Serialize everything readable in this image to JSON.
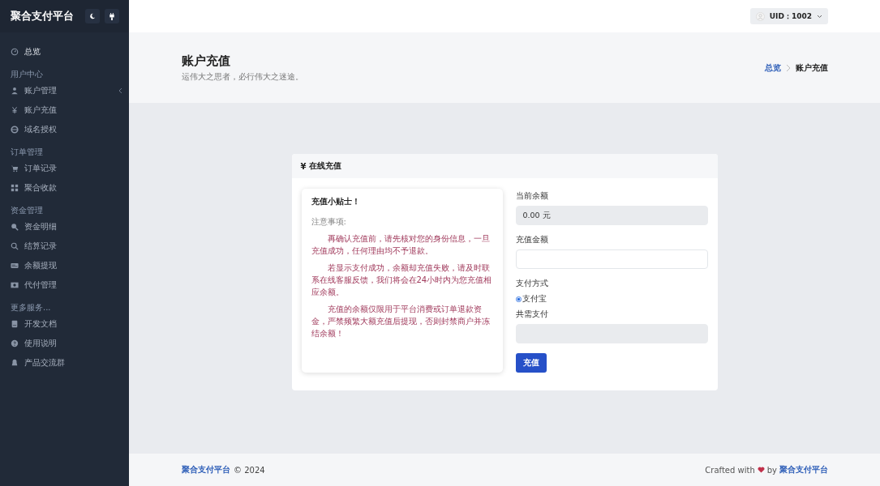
{
  "sidebar": {
    "brand": "聚合支付平台",
    "groups": [
      {
        "items": [
          {
            "label": "总览",
            "expandable": false
          }
        ]
      },
      {
        "title": "用户中心",
        "items": [
          {
            "label": "账户管理",
            "expandable": true
          },
          {
            "label": "账户充值",
            "expandable": false
          },
          {
            "label": "域名授权",
            "expandable": false
          }
        ]
      },
      {
        "title": "订单管理",
        "items": [
          {
            "label": "订单记录",
            "expandable": false
          },
          {
            "label": "聚合收款",
            "expandable": false
          }
        ]
      },
      {
        "title": "资金管理",
        "items": [
          {
            "label": "资金明细",
            "expandable": false
          },
          {
            "label": "结算记录",
            "expandable": false
          },
          {
            "label": "余额提现",
            "expandable": false
          },
          {
            "label": "代付管理",
            "expandable": false
          }
        ]
      },
      {
        "title": "更多服务...",
        "items": [
          {
            "label": "开发文档",
            "expandable": false
          },
          {
            "label": "使用说明",
            "expandable": false
          },
          {
            "label": "产品交流群",
            "expandable": false
          }
        ]
      }
    ]
  },
  "topbar": {
    "user": "UID：1002"
  },
  "page_header": {
    "title": "账户充值",
    "subtitle": "运伟大之思者，必行伟大之迷途。",
    "breadcrumb": [
      {
        "label": "总览",
        "link": true
      },
      {
        "label": "账户充值",
        "link": false
      }
    ]
  },
  "card": {
    "icon_char": "¥",
    "title": "在线充值",
    "tips": {
      "title": "充值小贴士！",
      "note": "注意事项:",
      "paragraphs": [
        "再确认充值前，请先核对您的身份信息，一旦充值成功，任何理由均不予退款。",
        "若显示支付成功，余额却充值失败，请及时联系在线客服反馈，我们将会在24小时内为您充值相应余额。",
        "充值的余额仅限用于平台消费或订单退款资金，严禁频繁大额充值后提现，否则封禁商户并冻结余额！"
      ]
    },
    "form": {
      "balance_label": "当前余额",
      "balance_value": "0.00 元",
      "amount_label": "充值金额",
      "method_label": "支付方式",
      "methods": [
        {
          "label": "支付宝",
          "selected": true
        }
      ],
      "total_label": "共需支付",
      "submit": "充值"
    }
  },
  "footer": {
    "brand": "聚合支付平台",
    "copyright": "© 2024",
    "credit_prefix": "Crafted with",
    "credit_by": "by",
    "credit_brand": "聚合支付平台"
  }
}
